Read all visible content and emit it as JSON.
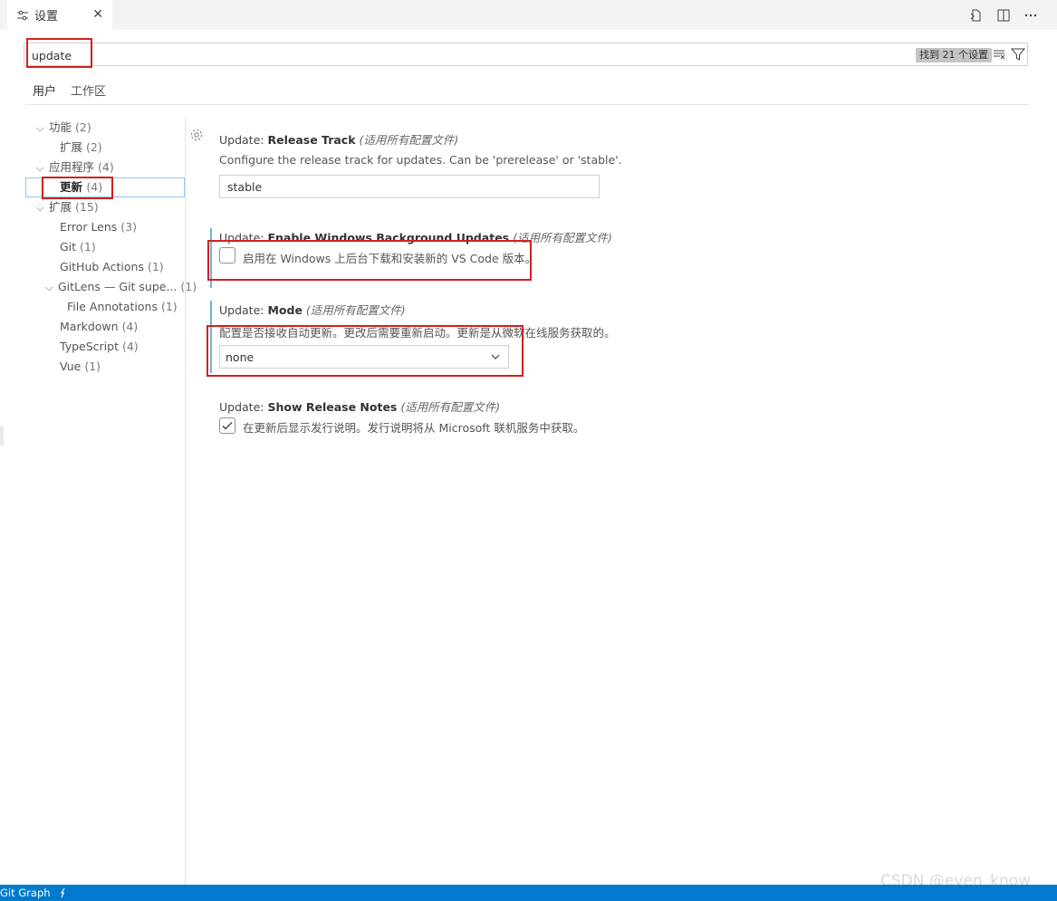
{
  "tab": {
    "label": "设置",
    "close": "✕"
  },
  "search": {
    "value": "update",
    "result_count": "找到 21 个设置"
  },
  "scopes": [
    "用户",
    "工作区"
  ],
  "toc": [
    {
      "label": "功能",
      "count": "(2)"
    },
    {
      "label": "扩展",
      "count": "(2)"
    },
    {
      "label": "应用程序",
      "count": "(4)"
    },
    {
      "label": "更新",
      "count": "(4)"
    },
    {
      "label": "扩展",
      "count": "(15)"
    },
    {
      "label": "Error Lens",
      "count": "(3)"
    },
    {
      "label": "Git",
      "count": "(1)"
    },
    {
      "label": "GitHub Actions",
      "count": "(1)"
    },
    {
      "label": "GitLens — Git supe...",
      "count": "(1)"
    },
    {
      "label": "File Annotations",
      "count": "(1)"
    },
    {
      "label": "Markdown",
      "count": "(4)"
    },
    {
      "label": "TypeScript",
      "count": "(4)"
    },
    {
      "label": "Vue",
      "count": "(1)"
    }
  ],
  "settings": {
    "release_track": {
      "category": "Update: ",
      "key": "Release Track",
      "scope": "(适用所有配置文件)",
      "desc": "Configure the release track for updates. Can be 'prerelease' or 'stable'.",
      "value": "stable"
    },
    "bg_updates": {
      "category": "Update: ",
      "key": "Enable Windows Background Updates",
      "scope": "(适用所有配置文件)",
      "label": "启用在 Windows 上后台下载和安装新的 VS Code 版本。",
      "checked": false
    },
    "mode": {
      "category": "Update: ",
      "key": "Mode",
      "scope": "(适用所有配置文件)",
      "desc": "配置是否接收自动更新。更改后需要重新启动。更新是从微软在线服务获取的。",
      "value": "none"
    },
    "release_notes": {
      "category": "Update: ",
      "key": "Show Release Notes",
      "scope": "(适用所有配置文件)",
      "label": "在更新后显示发行说明。发行说明将从 Microsoft 联机服务中获取。",
      "checked": true
    }
  },
  "statusbar": {
    "git_graph": "Git Graph"
  },
  "watermark": "CSDN @even_know",
  "colors": {
    "statusbar": "#007acc",
    "highlight_border": "#d32020",
    "modified_bar": "#6cb4e0"
  }
}
